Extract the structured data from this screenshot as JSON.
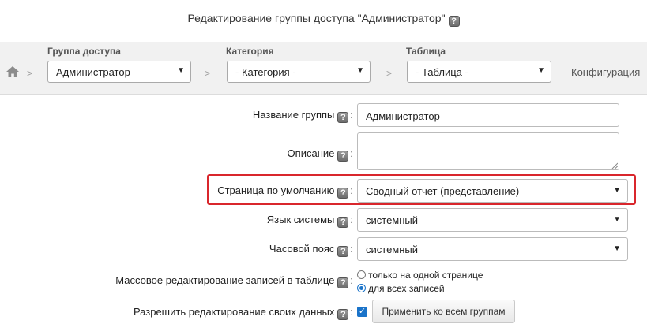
{
  "header": {
    "title": "Редактирование группы доступа \"Администратор\"",
    "help": "?"
  },
  "breadcrumb": {
    "separator": ">",
    "group": {
      "label": "Группа доступа",
      "value": "Администратор"
    },
    "category": {
      "label": "Категория",
      "value": "- Категория -"
    },
    "table": {
      "label": "Таблица",
      "value": "- Таблица -"
    },
    "config_link": "Конфигурация"
  },
  "form": {
    "help": "?",
    "colon": ":",
    "group_name": {
      "label": "Название группы",
      "value": "Администратор"
    },
    "description": {
      "label": "Описание",
      "value": ""
    },
    "default_page": {
      "label": "Страница по умолчанию",
      "value": "Сводный отчет (представление)"
    },
    "language": {
      "label": "Язык системы",
      "value": "системный"
    },
    "timezone": {
      "label": "Часовой пояс",
      "value": "системный"
    },
    "mass_edit": {
      "label": "Массовое редактирование записей в таблице",
      "options": [
        "только на одной странице",
        "для всех записей"
      ],
      "selected": 1
    },
    "self_edit": {
      "label": "Разрешить редактирование своих данных",
      "checked": true
    },
    "apply_button": "Применить ко всем группам"
  },
  "colors": {
    "highlight": "#d9262c",
    "accent": "#1a73c9"
  }
}
